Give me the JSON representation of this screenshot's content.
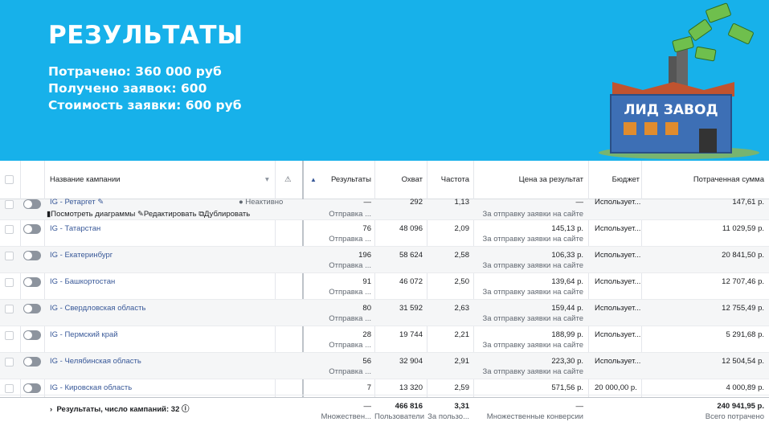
{
  "hero": {
    "title": "РЕЗУЛЬТАТЫ",
    "stats": [
      {
        "label": "Потрачено:",
        "value": "360 000 руб"
      },
      {
        "label": "Получено заявок:",
        "value": "600"
      },
      {
        "label": "Стоимость заявки:",
        "value": "600 руб"
      }
    ],
    "logo_text": "ЛИД ЗАВОД",
    "colors": {
      "background": "#17b1ea",
      "factory": "#3d6fb5",
      "roof": "#c0532f"
    }
  },
  "table": {
    "columns": {
      "name": "Название кампании",
      "results": "Результаты",
      "reach": "Охват",
      "frequency": "Частота",
      "cost": "Цена за результат",
      "budget": "Бюджет",
      "spent": "Потраченная сумма"
    },
    "first_row": {
      "name": "IG - Ретаргет",
      "status": "Неактивно",
      "results": "—",
      "results_sub": "Отправка ...",
      "reach": "292",
      "frequency": "1,13",
      "cost": "—",
      "cost_sub": "За отправку заявки на сайте",
      "budget": "Использует...",
      "spent": "147,61 р.",
      "actions": {
        "charts": "Посмотреть диаграммы",
        "edit": "Редактировать",
        "duplicate": "Дублировать"
      }
    },
    "rows": [
      {
        "name": "IG - Татарстан",
        "results": "76",
        "results_sub": "Отправка ...",
        "reach": "48 096",
        "frequency": "2,09",
        "cost": "145,13 р.",
        "cost_sub": "За отправку заявки на сайте",
        "budget": "Использует...",
        "spent": "11 029,59 р."
      },
      {
        "name": "IG - Екатеринбург",
        "results": "196",
        "results_sub": "Отправка ...",
        "reach": "58 624",
        "frequency": "2,58",
        "cost": "106,33 р.",
        "cost_sub": "За отправку заявки на сайте",
        "budget": "Использует...",
        "spent": "20 841,50 р."
      },
      {
        "name": "IG - Башкортостан",
        "results": "91",
        "results_sub": "Отправка ...",
        "reach": "46 072",
        "frequency": "2,50",
        "cost": "139,64 р.",
        "cost_sub": "За отправку заявки на сайте",
        "budget": "Использует...",
        "spent": "12 707,46 р."
      },
      {
        "name": "IG - Свердловская область",
        "results": "80",
        "results_sub": "Отправка ...",
        "reach": "31 592",
        "frequency": "2,63",
        "cost": "159,44 р.",
        "cost_sub": "За отправку заявки на сайте",
        "budget": "Использует...",
        "spent": "12 755,49 р."
      },
      {
        "name": "IG - Пермский край",
        "results": "28",
        "results_sub": "Отправка ...",
        "reach": "19 744",
        "frequency": "2,21",
        "cost": "188,99 р.",
        "cost_sub": "За отправку заявки на сайте",
        "budget": "Использует...",
        "spent": "5 291,68 р."
      },
      {
        "name": "IG - Челябинская область",
        "results": "56",
        "results_sub": "Отправка ...",
        "reach": "32 904",
        "frequency": "2,91",
        "cost": "223,30 р.",
        "cost_sub": "За отправку заявки на сайте",
        "budget": "Использует...",
        "spent": "12 504,54 р."
      },
      {
        "name": "IG - Кировская область",
        "results": "7",
        "results_sub": "",
        "reach": "13 320",
        "frequency": "2,59",
        "cost": "571,56 р.",
        "cost_sub": "",
        "budget": "20 000,00 р.",
        "spent": "4 000,89 р."
      }
    ],
    "footer": {
      "label": "Результаты, число кампаний: 32",
      "results": "—",
      "results_sub": "Множествен...",
      "reach": "466 816",
      "reach_sub": "Пользователи",
      "frequency": "3,31",
      "frequency_sub": "За пользо...",
      "cost": "—",
      "cost_sub": "Множественные конверсии",
      "spent": "240 941,95 р.",
      "spent_sub": "Всего потрачено"
    }
  }
}
